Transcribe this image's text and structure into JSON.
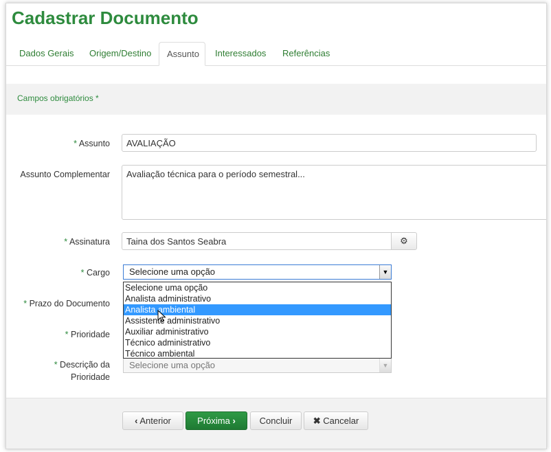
{
  "page_title": "Cadastrar Documento",
  "tabs": [
    {
      "label": "Dados Gerais"
    },
    {
      "label": "Origem/Destino"
    },
    {
      "label": "Assunto",
      "active": true
    },
    {
      "label": "Interessados"
    },
    {
      "label": "Referências"
    }
  ],
  "notice": "Campos obrigatórios *",
  "required_mark": "*",
  "fields": {
    "assunto": {
      "label": "Assunto",
      "value": "AVALIAÇÃO"
    },
    "assunto_complementar": {
      "label": "Assunto Complementar",
      "value": "Avaliação técnica para o período semestral..."
    },
    "assinatura": {
      "label": "Assinatura",
      "value": "Taina dos Santos Seabra",
      "button_icon": "gear-icon"
    },
    "cargo": {
      "label": "Cargo",
      "selected": "Selecione uma opção",
      "options": [
        "Selecione uma opção",
        "Analista administrativo",
        "Analista ambiental",
        "Assistente administrativo",
        "Auxiliar administrativo",
        "Técnico administrativo",
        "Técnico ambiental"
      ],
      "highlighted": "Analista ambiental"
    },
    "prazo": {
      "label": "Prazo do Documento"
    },
    "prioridade": {
      "label": "Prioridade"
    },
    "descricao_prioridade": {
      "label_line1": "Descrição da",
      "label_line2": "Prioridade",
      "selected": "Selecione uma opção"
    }
  },
  "buttons": {
    "anterior": {
      "label": "Anterior",
      "icon": "chevron-left-icon"
    },
    "proxima": {
      "label": "Próxima",
      "icon": "chevron-right-icon"
    },
    "concluir": {
      "label": "Concluir"
    },
    "cancelar": {
      "label": "Cancelar",
      "icon": "close-icon"
    }
  },
  "colors": {
    "brand_green": "#2e8b3e",
    "highlight_blue": "#3399ff"
  }
}
